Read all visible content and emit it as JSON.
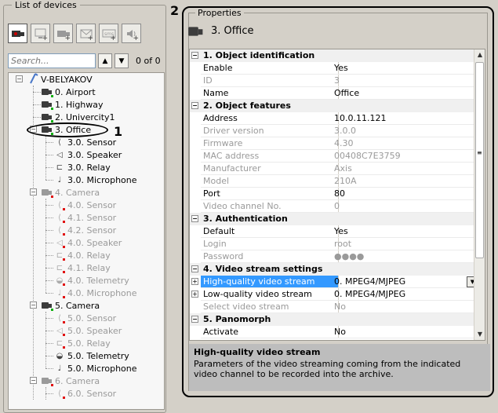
{
  "left_panel": {
    "title": "List of devices",
    "search_placeholder": "Search...",
    "search_count": "0 of 0",
    "tree": [
      {
        "label": "V-BELYAKOV",
        "kind": "server",
        "dim": false
      },
      {
        "label": "0. Airport",
        "kind": "camera",
        "dim": false
      },
      {
        "label": "1. Highway",
        "kind": "camera",
        "dim": false
      },
      {
        "label": "2. Univercity1",
        "kind": "camera",
        "dim": false
      },
      {
        "label": "3. Office",
        "kind": "camera",
        "dim": false
      },
      {
        "label": "3.0. Sensor",
        "kind": "sensor",
        "dim": false
      },
      {
        "label": "3.0. Speaker",
        "kind": "speaker",
        "dim": false
      },
      {
        "label": "3.0. Relay",
        "kind": "relay",
        "dim": false
      },
      {
        "label": "3.0. Microphone",
        "kind": "microphone",
        "dim": false
      },
      {
        "label": "4. Camera",
        "kind": "camera",
        "dim": true
      },
      {
        "label": "4.0. Sensor",
        "kind": "sensor",
        "dim": true
      },
      {
        "label": "4.1. Sensor",
        "kind": "sensor",
        "dim": true
      },
      {
        "label": "4.2. Sensor",
        "kind": "sensor",
        "dim": true
      },
      {
        "label": "4.0. Speaker",
        "kind": "speaker",
        "dim": true
      },
      {
        "label": "4.0. Relay",
        "kind": "relay",
        "dim": true
      },
      {
        "label": "4.1. Relay",
        "kind": "relay",
        "dim": true
      },
      {
        "label": "4.0. Telemetry",
        "kind": "telemetry",
        "dim": true
      },
      {
        "label": "4.0. Microphone",
        "kind": "microphone",
        "dim": true
      },
      {
        "label": "5. Camera",
        "kind": "camera",
        "dim": false
      },
      {
        "label": "5.0. Sensor",
        "kind": "sensor",
        "dim": true
      },
      {
        "label": "5.0. Speaker",
        "kind": "speaker",
        "dim": true
      },
      {
        "label": "5.0. Relay",
        "kind": "relay",
        "dim": true
      },
      {
        "label": "5.0. Telemetry",
        "kind": "telemetry",
        "dim": false
      },
      {
        "label": "5.0. Microphone",
        "kind": "microphone",
        "dim": false
      },
      {
        "label": "6. Camera",
        "kind": "camera",
        "dim": true
      },
      {
        "label": "6.0. Sensor",
        "kind": "sensor",
        "dim": true
      }
    ]
  },
  "annotations": {
    "one": "1",
    "two": "2"
  },
  "right_panel": {
    "title": "Properties",
    "object_title": "3. Office",
    "rows": [
      {
        "type": "category",
        "name": "1. Object identification"
      },
      {
        "type": "prop",
        "name": "Enable",
        "value": "Yes",
        "dim": false
      },
      {
        "type": "prop",
        "name": "ID",
        "value": "3",
        "dim": true
      },
      {
        "type": "prop",
        "name": "Name",
        "value": "Office",
        "dim": false
      },
      {
        "type": "category",
        "name": "2. Object features"
      },
      {
        "type": "prop",
        "name": "Address",
        "value": "10.0.11.121",
        "dim": false
      },
      {
        "type": "prop",
        "name": "Driver version",
        "value": "3.0.0",
        "dim": true
      },
      {
        "type": "prop",
        "name": "Firmware",
        "value": "4.30",
        "dim": true
      },
      {
        "type": "prop",
        "name": "MAC address",
        "value": "00408C7E3759",
        "dim": true
      },
      {
        "type": "prop",
        "name": "Manufacturer",
        "value": "Axis",
        "dim": true
      },
      {
        "type": "prop",
        "name": "Model",
        "value": "210A",
        "dim": true
      },
      {
        "type": "prop",
        "name": "Port",
        "value": "80",
        "dim": false
      },
      {
        "type": "prop",
        "name": "Video channel No.",
        "value": "0",
        "dim": true
      },
      {
        "type": "category",
        "name": "3. Authentication"
      },
      {
        "type": "prop",
        "name": "Default",
        "value": "Yes",
        "dim": false
      },
      {
        "type": "prop",
        "name": "Login",
        "value": "root",
        "dim": true
      },
      {
        "type": "prop",
        "name": "Password",
        "value": "●●●●",
        "dim": true
      },
      {
        "type": "category",
        "name": "4. Video stream settings"
      },
      {
        "type": "prop",
        "name": "High-quality video stream",
        "value": "0. MPEG4/MJPEG",
        "dim": false,
        "expandable": true,
        "selected": true,
        "dropdown": true
      },
      {
        "type": "prop",
        "name": "Low-quality video stream",
        "value": "0. MPEG4/MJPEG",
        "dim": false,
        "expandable": true
      },
      {
        "type": "prop",
        "name": "Select video stream",
        "value": "No",
        "dim": true
      },
      {
        "type": "category",
        "name": "5. Panomorph"
      },
      {
        "type": "prop",
        "name": "Activate",
        "value": "No",
        "dim": false
      }
    ],
    "description_title": "High-quality video stream",
    "description_text": "Parameters of the video streaming coming from the indicated video channel to be recorded into the archive."
  }
}
